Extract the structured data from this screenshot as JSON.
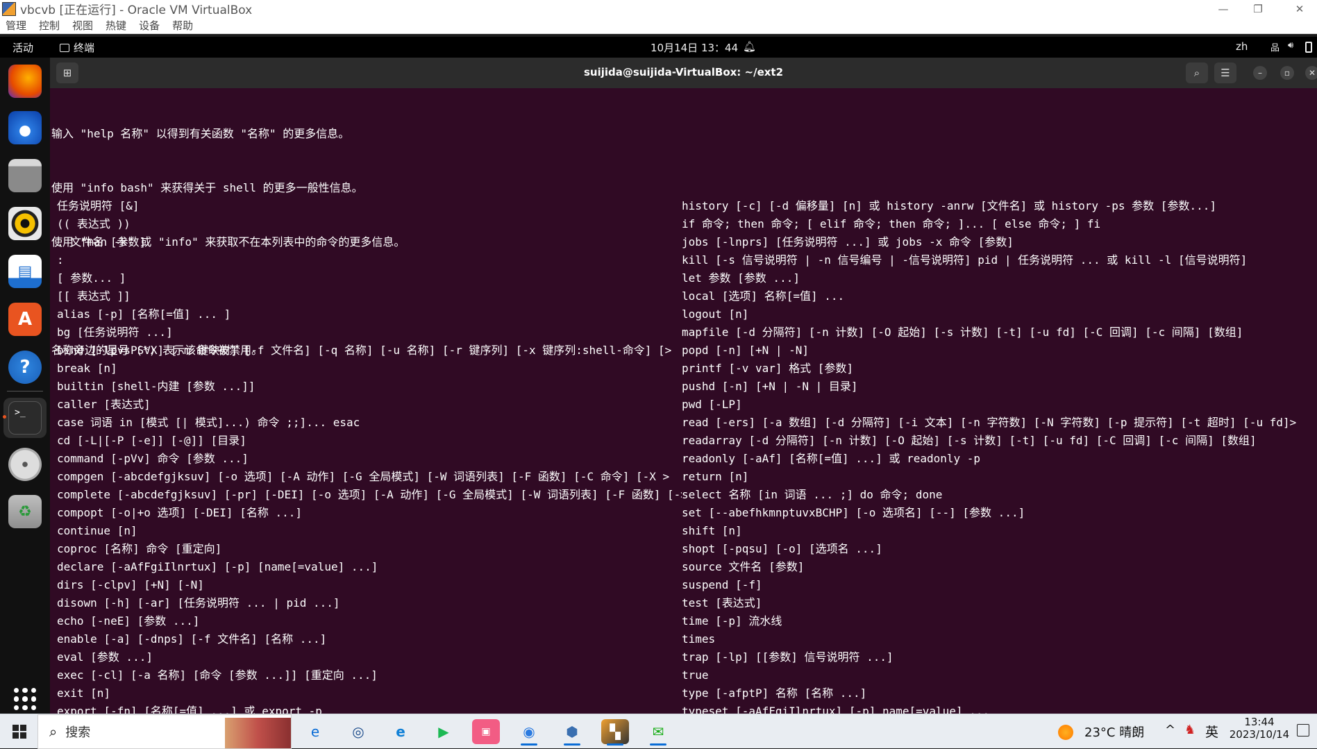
{
  "vbox": {
    "title": "vbcvb [正在运行] - Oracle VM VirtualBox",
    "menu": [
      "管理",
      "控制",
      "视图",
      "热键",
      "设备",
      "帮助"
    ],
    "window_controls": {
      "minimize": "—",
      "restore": "❐",
      "close": "✕"
    }
  },
  "gnome": {
    "activities": "活动",
    "app_menu": "终端",
    "clock": "10月14日 13：44",
    "input_method": "zh"
  },
  "dock": {
    "icons": [
      "firefox-icon",
      "thunderbird-icon",
      "files-icon",
      "rhythmbox-icon",
      "libreoffice-writer-icon",
      "app-center-icon",
      "help-icon",
      "terminal-icon",
      "dvd-icon",
      "trash-icon",
      "show-apps-icon"
    ]
  },
  "terminal": {
    "title": "suijida@suijida-VirtualBox: ~/ext2",
    "intro": [
      "输入 \"help 名称\" 以得到有关函数 \"名称\" 的更多信息。",
      "使用 \"info bash\" 来获得关于 shell 的更多一般性信息。",
      "使用 \"man -k\" 或 \"info\" 来获取不在本列表中的命令的更多信息。",
      "",
      "名称旁边的星号 (*) 表示该命令被禁用。"
    ],
    "left_commands": [
      "任务说明符 [&]",
      "(( 表达式 ))",
      ". 文件名 [参数]",
      ":",
      "[ 参数... ]",
      "[[ 表达式 ]]",
      "alias [-p] [名称[=值] ... ]",
      "bg [任务说明符 ...]",
      "bind [-lpvsPSVX] [-m 键映射] [-f 文件名] [-q 名称] [-u 名称] [-r 键序列] [-x 键序列:shell-命令] [>",
      "break [n]",
      "builtin [shell-内建 [参数 ...]]",
      "caller [表达式]",
      "case 词语 in [模式 [| 模式]...) 命令 ;;]... esac",
      "cd [-L|[-P [-e]] [-@]] [目录]",
      "command [-pVv] 命令 [参数 ...]",
      "compgen [-abcdefgjksuv] [-o 选项] [-A 动作] [-G 全局模式] [-W 词语列表] [-F 函数] [-C 命令] [-X >",
      "complete [-abcdefgjksuv] [-pr] [-DEI] [-o 选项] [-A 动作] [-G 全局模式] [-W 词语列表] [-F 函数] [->",
      "compopt [-o|+o 选项] [-DEI] [名称 ...]",
      "continue [n]",
      "coproc [名称] 命令 [重定向]",
      "declare [-aAfFgiIlnrtux] [-p] [name[=value] ...]",
      "dirs [-clpv] [+N] [-N]",
      "disown [-h] [-ar] [任务说明符 ... | pid ...]",
      "echo [-neE] [参数 ...]",
      "enable [-a] [-dnps] [-f 文件名] [名称 ...]",
      "eval [参数 ...]",
      "exec [-cl] [-a 名称] [命令 [参数 ...]] [重定向 ...]",
      "exit [n]",
      "export [-fn] [名称[=值] ...] 或 export -p"
    ],
    "right_commands": [
      "history [-c] [-d 偏移量] [n] 或 history -anrw [文件名] 或 history -ps 参数 [参数...]",
      "if 命令; then 命令; [ elif 命令; then 命令; ]... [ else 命令; ] fi",
      "jobs [-lnprs] [任务说明符 ...] 或 jobs -x 命令 [参数]",
      "kill [-s 信号说明符 | -n 信号编号 | -信号说明符] pid | 任务说明符 ... 或 kill -l [信号说明符]",
      "let 参数 [参数 ...]",
      "local [选项] 名称[=值] ...",
      "logout [n]",
      "mapfile [-d 分隔符] [-n 计数] [-O 起始] [-s 计数] [-t] [-u fd] [-C 回调] [-c 间隔] [数组]",
      "popd [-n] [+N | -N]",
      "printf [-v var] 格式 [参数]",
      "pushd [-n] [+N | -N | 目录]",
      "pwd [-LP]",
      "read [-ers] [-a 数组] [-d 分隔符] [-i 文本] [-n 字符数] [-N 字符数] [-p 提示符] [-t 超时] [-u fd]>",
      "readarray [-d 分隔符] [-n 计数] [-O 起始] [-s 计数] [-t] [-u fd] [-C 回调] [-c 间隔] [数组]",
      "readonly [-aAf] [名称[=值] ...] 或 readonly -p",
      "return [n]",
      "select 名称 [in 词语 ... ;] do 命令; done",
      "set [--abefhkmnptuvxBCHP] [-o 选项名] [--] [参数 ...]",
      "shift [n]",
      "shopt [-pqsu] [-o] [选项名 ...]",
      "source 文件名 [参数]",
      "suspend [-f]",
      "test [表达式]",
      "time [-p] 流水线",
      "times",
      "trap [-lp] [[参数] 信号说明符 ...]",
      "true",
      "type [-afptP] 名称 [名称 ...]",
      "typeset [-aAfFgiIlnrtux] [-p] name[=value] ..."
    ]
  },
  "taskbar": {
    "search_placeholder": "搜索",
    "weather": "23°C 晴朗",
    "ime": "英",
    "time": "13:44",
    "date": "2023/10/14"
  }
}
